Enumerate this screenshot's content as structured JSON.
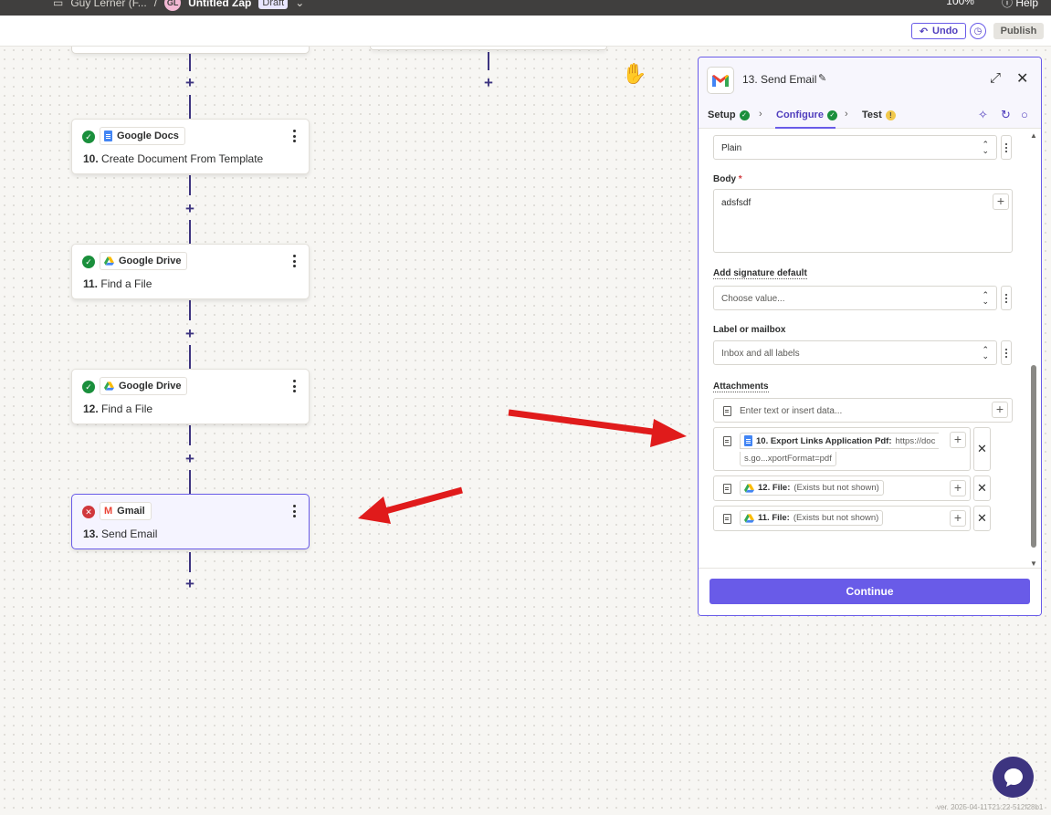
{
  "topbar": {
    "folder": "Guy Lerner (F...",
    "separator": "/",
    "avatar_initials": "GL",
    "zap_name": "Untitled Zap",
    "status": "Draft",
    "zoom": "100%",
    "help": "Help"
  },
  "toolbar": {
    "undo_label": "Undo",
    "publish_label": "Publish"
  },
  "steps": [
    {
      "app": "Google Docs",
      "number": "10.",
      "title": "Create Document From Template",
      "status": "ok"
    },
    {
      "app": "Google Drive",
      "number": "11.",
      "title": "Find a File",
      "status": "ok"
    },
    {
      "app": "Google Drive",
      "number": "12.",
      "title": "Find a File",
      "status": "ok"
    },
    {
      "app": "Gmail",
      "number": "13.",
      "title": "Send Email",
      "status": "error"
    }
  ],
  "panel": {
    "title": "13. Send Email",
    "tabs": {
      "setup": "Setup",
      "configure": "Configure",
      "test": "Test"
    },
    "body_format": {
      "value": "Plain"
    },
    "body": {
      "label": "Body",
      "required_mark": "*",
      "value": "adsfsdf"
    },
    "signature": {
      "label": "Add signature default",
      "placeholder": "Choose value..."
    },
    "label_mailbox": {
      "label": "Label or mailbox",
      "value": "Inbox and all labels"
    },
    "attachments": {
      "label": "Attachments",
      "input_placeholder": "Enter text or insert data...",
      "items": [
        {
          "label": "10. Export Links Application Pdf:",
          "value_line1": "https://doc",
          "value_line2": "s.go...xportFormat=pdf"
        },
        {
          "label": "12. File:",
          "value": "(Exists but not shown)"
        },
        {
          "label": "11. File:",
          "value": "(Exists but not shown)"
        }
      ]
    },
    "continue_label": "Continue"
  },
  "footer": {
    "version": "ver. 2025-04-11T21:22-512f28b1"
  },
  "colors": {
    "accent": "#695be8",
    "connector": "#3d3480",
    "success": "#1a8f3c",
    "error": "#d0383c",
    "annotation_arrow": "#e01b1b"
  }
}
